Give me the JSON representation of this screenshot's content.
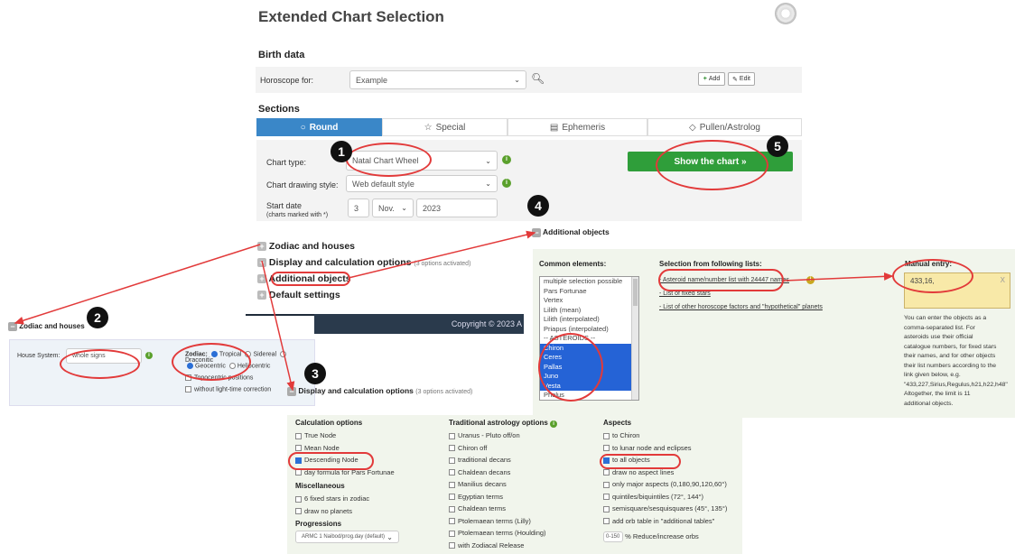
{
  "header": {
    "title": "Extended Chart Selection",
    "logo_icon": "zodiac-wheel-icon"
  },
  "birth": {
    "heading": "Birth data",
    "label": "Horoscope for:",
    "value": "Example",
    "add_label": "Add",
    "edit_label": "Edit"
  },
  "sections": {
    "heading": "Sections",
    "tabs": [
      {
        "label": "Round",
        "icon": "circle-icon"
      },
      {
        "label": "Special",
        "icon": "star-icon"
      },
      {
        "label": "Ephemeris",
        "icon": "document-icon"
      },
      {
        "label": "Pullen/Astrolog",
        "icon": "diamond-icon"
      }
    ]
  },
  "form": {
    "chart_type_label": "Chart type:",
    "chart_type_value": "Natal Chart Wheel",
    "drawing_style_label": "Chart drawing style:",
    "drawing_style_value": "Web default style",
    "start_date_label": "Start date",
    "start_date_note": "(charts marked with *)",
    "day": "3",
    "month": "Nov.",
    "year": "2023",
    "show_chart": "Show the chart »"
  },
  "collapsed": {
    "zodiac": "Zodiac and houses",
    "display": "Display and calculation options",
    "display_note": "(3 options activated)",
    "additional": "Additional objects",
    "defaults": "Default settings"
  },
  "footer": {
    "copyright": "Copyright © 2023 A"
  },
  "zodiac_panel": {
    "title": "Zodiac and houses",
    "house_label": "House System:",
    "house_value": "whole signs",
    "zodiac_label": "Zodiac:",
    "tropical": "Tropical",
    "sidereal": "Sidereal",
    "draconitic": "Draconitic",
    "geocentric": "Geocentric",
    "heliocentric": "Heliocentric",
    "topocentric": "Topocentric positions",
    "light_time": "without light-time correction"
  },
  "additional_panel": {
    "title": "Additional objects",
    "common_head": "Common elements:",
    "lists_head": "Selection from following lists:",
    "manual_head": "Manual entry:",
    "common_items": [
      {
        "label": "multiple selection possible",
        "selected": false
      },
      {
        "label": "Pars Fortunae",
        "selected": false
      },
      {
        "label": "Vertex",
        "selected": false
      },
      {
        "label": "Lilith (mean)",
        "selected": false
      },
      {
        "label": "Lilith (interpolated)",
        "selected": false
      },
      {
        "label": "Priapus (interpolated)",
        "selected": false
      },
      {
        "label": "-- ASTEROIDS --",
        "selected": false
      },
      {
        "label": "Chiron",
        "selected": true
      },
      {
        "label": "Ceres",
        "selected": true
      },
      {
        "label": "Pallas",
        "selected": true
      },
      {
        "label": "Juno",
        "selected": true
      },
      {
        "label": "Vesta",
        "selected": true
      },
      {
        "label": "Pholus",
        "selected": false
      }
    ],
    "link_asteroid": "- Asteroid name/number list with 24447 names",
    "link_fixed": "- List of fixed stars",
    "link_other": "- List of other horoscope factors and \"hypothetical\" planets",
    "manual_value": "433,16,",
    "manual_clear": "X",
    "manual_help": [
      "You can enter the objects as a",
      "comma-separated list. For",
      "asteroids use their official",
      "catalogue numbers, for fixed stars",
      "their names, and for other objects",
      "their list numbers according to the",
      "link given below, e.g.",
      "\"433,227,Sirius,Regulus,h21,h22,h48\"",
      "Altogether, the limit is 11",
      "additional objects."
    ]
  },
  "display_panel": {
    "title": "Display and calculation options",
    "note": "(3 options activated)",
    "calc_head": "Calculation options",
    "calc": [
      {
        "label": "True Node",
        "checked": false
      },
      {
        "label": "Mean Node",
        "checked": false
      },
      {
        "label": "Descending Node",
        "checked": true
      },
      {
        "label": "day formula for Pars Fortunae",
        "checked": false
      }
    ],
    "misc_head": "Miscellaneous",
    "misc": [
      {
        "label": "6 fixed stars in zodiac",
        "checked": false
      },
      {
        "label": "draw no planets",
        "checked": false
      }
    ],
    "prog_head": "Progressions",
    "prog_value": "ARMC 1 Naibod/prog.day (default)",
    "trad_head": "Traditional astrology options",
    "trad": [
      {
        "label": "Uranus - Pluto off/on",
        "checked": false
      },
      {
        "label": "Chiron off",
        "checked": false
      },
      {
        "label": "traditional decans",
        "checked": false
      },
      {
        "label": "Chaldean decans",
        "checked": false
      },
      {
        "label": "Manilius decans",
        "checked": false
      },
      {
        "label": "Egyptian terms",
        "checked": false
      },
      {
        "label": "Chaldean terms",
        "checked": false
      },
      {
        "label": "Ptolemaean terms (Lilly)",
        "checked": false
      },
      {
        "label": "Ptolemaean terms (Houlding)",
        "checked": false
      },
      {
        "label": "with Zodiacal Release",
        "checked": false
      }
    ],
    "aspects_head": "Aspects",
    "aspects": [
      {
        "label": "to Chiron",
        "checked": false
      },
      {
        "label": "to lunar node and eclipses",
        "checked": false
      },
      {
        "label": "to all objects",
        "checked": true
      },
      {
        "label": "draw no aspect lines",
        "checked": false
      },
      {
        "label": "only major aspects (0,180,90,120,60°)",
        "checked": false
      },
      {
        "label": "quintiles/biquintiles (72°, 144°)",
        "checked": false
      },
      {
        "label": "semisquare/sesquisquares (45°, 135°)",
        "checked": false
      },
      {
        "label": "add orb table in \"additional tables\"",
        "checked": false
      }
    ],
    "orb_value": "0-150",
    "orb_label": "% Reduce/increase orbs"
  },
  "annotations": [
    "1",
    "2",
    "3",
    "4",
    "5"
  ],
  "colors": {
    "accent_blue": "#3a87c8",
    "show_green": "#2f9e3a",
    "marker_red": "#e23a3a",
    "select_blue": "#2563d6"
  }
}
